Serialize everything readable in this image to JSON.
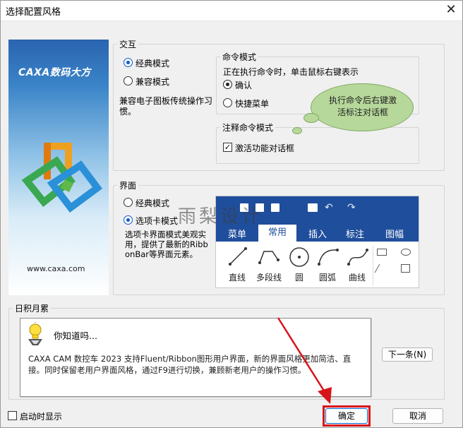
{
  "window": {
    "title": "选择配置风格",
    "close_glyph": "✕"
  },
  "logo": {
    "brand": "CAXA数码大方",
    "url": "www.caxa.com"
  },
  "interaction": {
    "legend": "交互",
    "classic_mode": "经典模式",
    "compatible_mode": "兼容模式",
    "description": "兼容电子图板传统操作习惯。",
    "command_mode": {
      "legend": "命令模式",
      "hint": "正在执行命令时，单击鼠标右键表示",
      "confirm": "确认",
      "shortcut_menu": "快捷菜单"
    },
    "annotation_mode": {
      "legend": "注释命令模式",
      "activate_dialog": "激活功能对话框"
    },
    "bubble": "执行命令后右键激活标注对话框"
  },
  "interface": {
    "legend": "界面",
    "classic_mode": "经典模式",
    "tab_mode": "选项卡模式",
    "description": "选项卡界面模式美观实用，提供了最新的RibbonBar等界面元素。",
    "watermark": "雨梨设计",
    "ribbon_tabs": [
      "菜单",
      "常用",
      "插入",
      "标注",
      "图幅"
    ],
    "tools": [
      "直线",
      "多段线",
      "圆",
      "圆弧",
      "曲线"
    ]
  },
  "tips": {
    "legend": "日积月累",
    "heading": "你知道吗...",
    "body": "CAXA CAM 数控车 2023 支持Fluent/Ribbon图形用户界面，新的界面风格更加简洁、直接。同时保留老用户界面风格，通过F9进行切换，兼顾新老用户的操作习惯。",
    "next_button": "下一条(N)"
  },
  "footer": {
    "show_on_start": "启动时显示",
    "ok": "确定",
    "cancel": "取消"
  },
  "colors": {
    "accent": "#0a58c8",
    "ribbon": "#1f4e9c",
    "annotation_red": "#d8141b",
    "bubble": "#b6d89a"
  }
}
